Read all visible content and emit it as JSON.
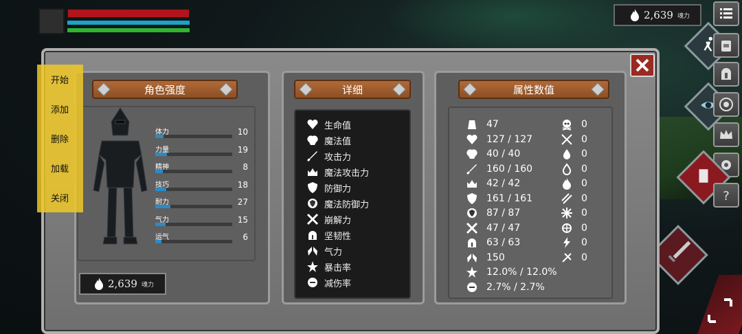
{
  "hud": {
    "soul_value": "2,639",
    "soul_unit": "魂力",
    "colors": {
      "hp": "#b1141c",
      "mp": "#1ba3c8",
      "stamina": "#2fb52f"
    }
  },
  "panels": {
    "character_title": "角色强度",
    "detail_title": "详细",
    "attribute_title": "属性数值"
  },
  "character": {
    "stats": [
      {
        "label": "体力",
        "value": "10",
        "fill": 0.11
      },
      {
        "label": "力量",
        "value": "19",
        "fill": 0.15
      },
      {
        "label": "精神",
        "value": "8",
        "fill": 0.1
      },
      {
        "label": "技巧",
        "value": "18",
        "fill": 0.14
      },
      {
        "label": "耐力",
        "value": "27",
        "fill": 0.2
      },
      {
        "label": "气力",
        "value": "15",
        "fill": 0.13
      },
      {
        "label": "运气",
        "value": "6",
        "fill": 0.08
      }
    ],
    "soul_value": "2,639",
    "soul_unit": "魂力"
  },
  "details": [
    {
      "label": "生命值",
      "icon": "heart-icon"
    },
    {
      "label": "魔法值",
      "icon": "brain-icon"
    },
    {
      "label": "攻击力",
      "icon": "sword-icon"
    },
    {
      "label": "魔法攻击力",
      "icon": "magic-attack-icon"
    },
    {
      "label": "防御力",
      "icon": "shield-icon"
    },
    {
      "label": "魔法防御力",
      "icon": "magic-shield-icon"
    },
    {
      "label": "崩解力",
      "icon": "break-icon"
    },
    {
      "label": "坚韧性",
      "icon": "helmet-icon"
    },
    {
      "label": "气力",
      "icon": "lungs-icon"
    },
    {
      "label": "暴击率",
      "icon": "crit-icon"
    },
    {
      "label": "减伤率",
      "icon": "reduce-icon"
    }
  ],
  "attributes_left": [
    {
      "value": "47",
      "icon": "weight-icon"
    },
    {
      "value": "127 / 127",
      "icon": "heart-icon"
    },
    {
      "value": "40 / 40",
      "icon": "brain-icon"
    },
    {
      "value": "160 / 160",
      "icon": "sword-icon"
    },
    {
      "value": "42 / 42",
      "icon": "magic-attack-icon"
    },
    {
      "value": "161 / 161",
      "icon": "shield-icon"
    },
    {
      "value": "87 / 87",
      "icon": "magic-shield-icon"
    },
    {
      "value": "47 / 47",
      "icon": "break-icon"
    },
    {
      "value": "63 / 63",
      "icon": "helmet-icon"
    },
    {
      "value": "150",
      "icon": "lungs-icon"
    },
    {
      "value": "12.0% / 12.0%",
      "icon": "crit-icon"
    },
    {
      "value": "2.7% / 2.7%",
      "icon": "reduce-icon"
    }
  ],
  "attributes_right": [
    {
      "value": "0",
      "icon": "skull-icon"
    },
    {
      "value": "0",
      "icon": "crossed-swords-icon"
    },
    {
      "value": "0",
      "icon": "drop-icon"
    },
    {
      "value": "0",
      "icon": "blood-icon"
    },
    {
      "value": "0",
      "icon": "fire-icon"
    },
    {
      "value": "0",
      "icon": "slash-icon"
    },
    {
      "value": "0",
      "icon": "snowflake-icon"
    },
    {
      "value": "0",
      "icon": "frost-icon"
    },
    {
      "value": "0",
      "icon": "lightning-icon"
    },
    {
      "value": "0",
      "icon": "curse-icon"
    }
  ],
  "menu": [
    "开始",
    "添加",
    "删除",
    "加载",
    "关闭"
  ]
}
